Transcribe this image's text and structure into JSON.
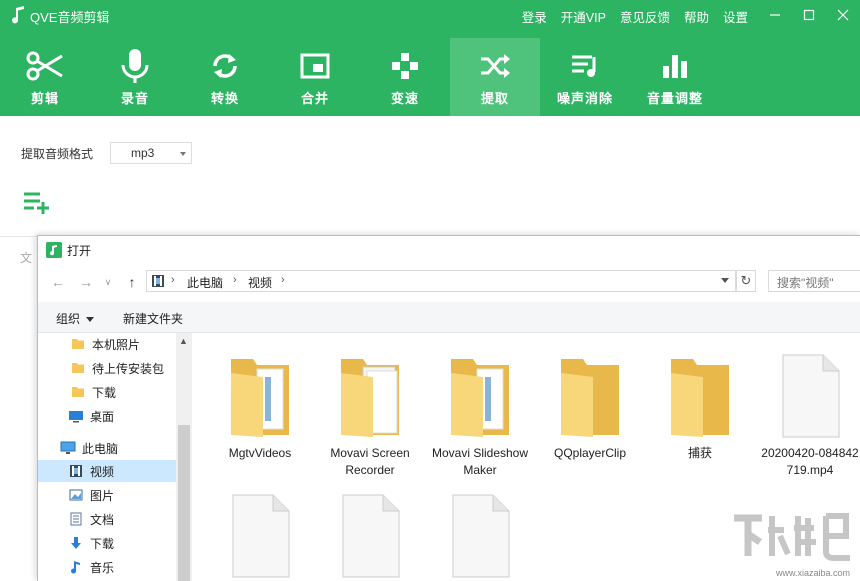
{
  "app": {
    "title": "QVE音频剪辑",
    "brand_color": "#2db462",
    "active_color": "#4fc37c",
    "links": [
      "登录",
      "开通VIP",
      "意见反馈",
      "帮助",
      "设置"
    ]
  },
  "toolbar": [
    {
      "label": "剪辑",
      "icon": "scissors-icon"
    },
    {
      "label": "录音",
      "icon": "microphone-icon"
    },
    {
      "label": "转换",
      "icon": "convert-icon"
    },
    {
      "label": "合并",
      "icon": "merge-icon"
    },
    {
      "label": "变速",
      "icon": "speed-icon"
    },
    {
      "label": "提取",
      "icon": "shuffle-icon",
      "active": true
    },
    {
      "label": "噪声消除",
      "icon": "noise-reduction-icon"
    },
    {
      "label": "音量调整",
      "icon": "volume-bars-icon"
    }
  ],
  "content": {
    "format_label": "提取音频格式",
    "format_value": "mp3",
    "file_label_partial": "文"
  },
  "dialog": {
    "title": "打开",
    "breadcrumb": [
      "此电脑",
      "视频"
    ],
    "search_placeholder": "搜索\"视频\"",
    "organize_label": "组织",
    "new_folder_label": "新建文件夹",
    "nav_items": [
      {
        "label": "本机照片",
        "icon": "folder-icon"
      },
      {
        "label": "待上传安装包",
        "icon": "folder-icon"
      },
      {
        "label": "下载",
        "icon": "folder-icon"
      },
      {
        "label": "桌面",
        "icon": "desktop-icon"
      },
      {
        "label": "此电脑",
        "icon": "computer-icon"
      },
      {
        "label": "视频",
        "icon": "video-icon",
        "selected": true
      },
      {
        "label": "图片",
        "icon": "pictures-icon"
      },
      {
        "label": "文档",
        "icon": "documents-icon"
      },
      {
        "label": "下载",
        "icon": "download-icon"
      },
      {
        "label": "音乐",
        "icon": "music-icon"
      }
    ],
    "files": [
      {
        "name": "MgtvVideos",
        "type": "folder-docs"
      },
      {
        "name": "Movavi Screen Recorder",
        "type": "folder-papers"
      },
      {
        "name": "Movavi Slideshow Maker",
        "type": "folder-docs"
      },
      {
        "name": "QQplayerClip",
        "type": "folder"
      },
      {
        "name": "捕获",
        "type": "folder"
      },
      {
        "name": "20200420-084842719.mp4",
        "type": "file"
      },
      {
        "name": "",
        "type": "file"
      },
      {
        "name": "",
        "type": "file"
      },
      {
        "name": "",
        "type": "file"
      }
    ]
  },
  "watermark": {
    "url": "www.xiazaiba.com"
  }
}
